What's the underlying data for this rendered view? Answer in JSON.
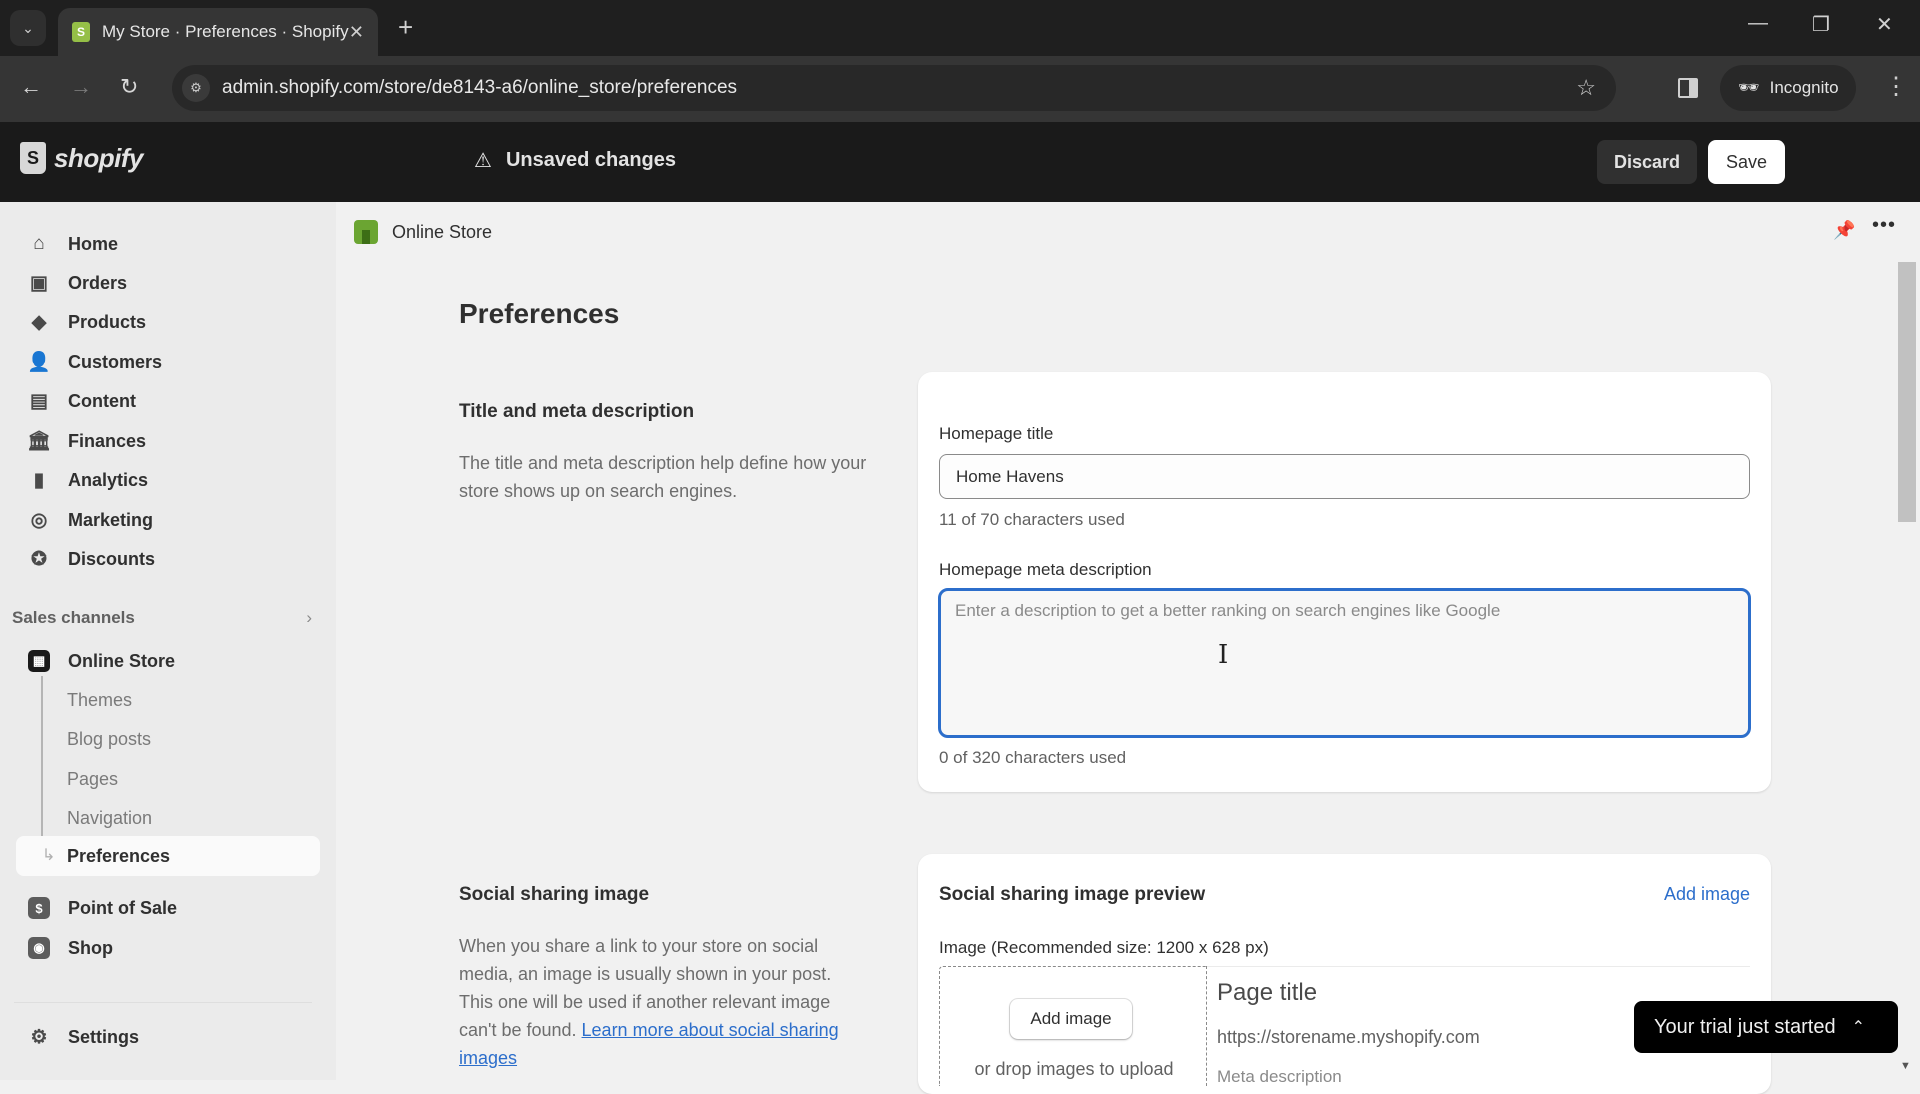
{
  "browser": {
    "tab_title": "My Store · Preferences · Shopify",
    "url": "admin.shopify.com/store/de8143-a6/online_store/preferences",
    "incognito_label": "Incognito"
  },
  "header": {
    "logo_text": "shopify",
    "unsaved_text": "Unsaved changes",
    "discard_label": "Discard",
    "save_label": "Save"
  },
  "sidebar": {
    "items": [
      {
        "label": "Home",
        "icon": "home-icon"
      },
      {
        "label": "Orders",
        "icon": "inbox-icon"
      },
      {
        "label": "Products",
        "icon": "tag-icon"
      },
      {
        "label": "Customers",
        "icon": "person-icon"
      },
      {
        "label": "Content",
        "icon": "image-icon"
      },
      {
        "label": "Finances",
        "icon": "bank-icon"
      },
      {
        "label": "Analytics",
        "icon": "bar-chart-icon"
      },
      {
        "label": "Marketing",
        "icon": "target-icon"
      },
      {
        "label": "Discounts",
        "icon": "discount-icon"
      }
    ],
    "sales_channels_label": "Sales channels",
    "online_store_label": "Online Store",
    "online_store_sub": [
      "Themes",
      "Blog posts",
      "Pages",
      "Navigation"
    ],
    "active_sub": "Preferences",
    "point_of_sale_label": "Point of Sale",
    "shop_label": "Shop",
    "settings_label": "Settings"
  },
  "breadcrumb": {
    "label": "Online Store"
  },
  "page": {
    "title": "Preferences",
    "meta_section": {
      "title": "Title and meta description",
      "description": "The title and meta description help define how your store shows up on search engines.",
      "homepage_title_label": "Homepage title",
      "homepage_title_value": "Home Havens",
      "homepage_title_count": "11 of 70 characters used",
      "meta_description_label": "Homepage meta description",
      "meta_description_value": "",
      "meta_description_placeholder": "Enter a description to get a better ranking on search engines like Google",
      "meta_description_count": "0 of 320 characters used"
    },
    "social_section": {
      "title": "Social sharing image",
      "description": "When you share a link to your store on social media, an image is usually shown in your post. This one will be used if another relevant image can't be found. ",
      "learn_more_link": "Learn more about social sharing images",
      "card_title": "Social sharing image preview",
      "add_image_link": "Add image",
      "image_label": "Image  (Recommended size: 1200 x 628 px)",
      "add_image_button": "Add image",
      "drop_text": "or drop images to upload",
      "preview_title": "Page title",
      "preview_url": "https://storename.myshopify.com",
      "preview_meta": "Meta description"
    }
  },
  "toast": {
    "label": "Your trial just started"
  },
  "colors": {
    "accent_blue": "#2c6ecb",
    "header_bg": "#1a1a1a",
    "shopify_green": "#95bf47"
  }
}
